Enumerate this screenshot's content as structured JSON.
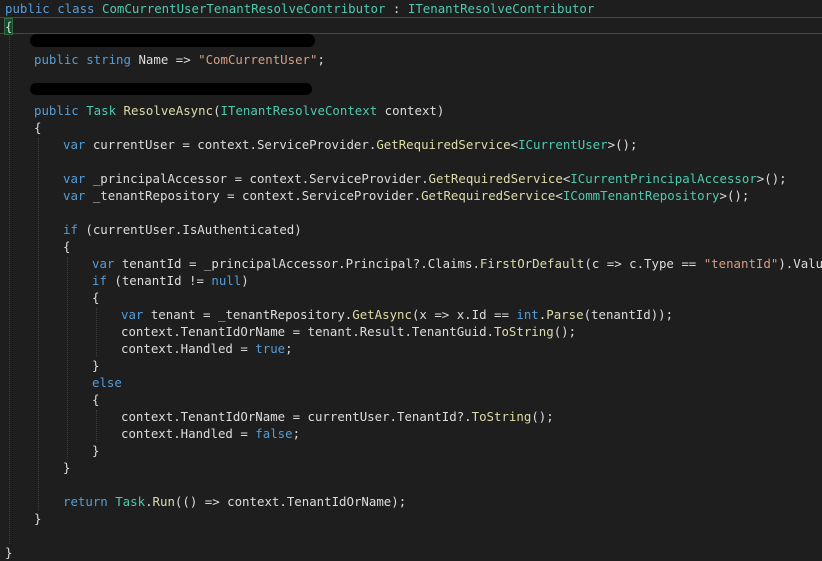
{
  "editor": {
    "lines": [
      {
        "indent": 0,
        "tokens": [
          [
            "keyword",
            "public "
          ],
          [
            "keyword",
            "class "
          ],
          [
            "type",
            "ComCurrentUserTenantResolveContributor"
          ],
          [
            "plain",
            " : "
          ],
          [
            "type",
            "ITenantResolveContributor"
          ]
        ]
      },
      {
        "indent": 0,
        "current": true,
        "tokens": [
          [
            "brace-matched",
            "{"
          ]
        ]
      },
      {
        "indent": 0,
        "tokens": []
      },
      {
        "indent": 1,
        "tokens": [
          [
            "keyword",
            "public "
          ],
          [
            "keyword",
            "string "
          ],
          [
            "plain",
            "Name => "
          ],
          [
            "string",
            "\"ComCurrentUser\""
          ],
          [
            "plain",
            ";"
          ]
        ]
      },
      {
        "indent": 0,
        "tokens": []
      },
      {
        "indent": 0,
        "tokens": []
      },
      {
        "indent": 1,
        "tokens": [
          [
            "keyword",
            "public "
          ],
          [
            "type",
            "Task "
          ],
          [
            "method",
            "ResolveAsync"
          ],
          [
            "plain",
            "("
          ],
          [
            "type",
            "ITenantResolveContext"
          ],
          [
            "plain",
            " context)"
          ]
        ]
      },
      {
        "indent": 1,
        "tokens": [
          [
            "plain",
            "{"
          ]
        ]
      },
      {
        "indent": 2,
        "tokens": [
          [
            "keyword",
            "var "
          ],
          [
            "plain",
            "currentUser = context.ServiceProvider."
          ],
          [
            "method",
            "GetRequiredService"
          ],
          [
            "plain",
            "<"
          ],
          [
            "type",
            "ICurrentUser"
          ],
          [
            "plain",
            ">();"
          ]
        ]
      },
      {
        "indent": 0,
        "tokens": []
      },
      {
        "indent": 2,
        "tokens": [
          [
            "keyword",
            "var "
          ],
          [
            "plain",
            "_principalAccessor = context.ServiceProvider."
          ],
          [
            "method",
            "GetRequiredService"
          ],
          [
            "plain",
            "<"
          ],
          [
            "type",
            "ICurrentPrincipalAccessor"
          ],
          [
            "plain",
            ">();"
          ]
        ]
      },
      {
        "indent": 2,
        "tokens": [
          [
            "keyword",
            "var "
          ],
          [
            "plain",
            "_tenantRepository = context.ServiceProvider."
          ],
          [
            "method",
            "GetRequiredService"
          ],
          [
            "plain",
            "<"
          ],
          [
            "type",
            "ICommTenantRepository"
          ],
          [
            "plain",
            ">();"
          ]
        ]
      },
      {
        "indent": 0,
        "tokens": []
      },
      {
        "indent": 2,
        "tokens": [
          [
            "keyword",
            "if "
          ],
          [
            "plain",
            "(currentUser.IsAuthenticated)"
          ]
        ]
      },
      {
        "indent": 2,
        "tokens": [
          [
            "plain",
            "{"
          ]
        ]
      },
      {
        "indent": 3,
        "tokens": [
          [
            "keyword",
            "var "
          ],
          [
            "plain",
            "tenantId = _principalAccessor.Principal?.Claims."
          ],
          [
            "method",
            "FirstOrDefault"
          ],
          [
            "plain",
            "(c => c.Type == "
          ],
          [
            "string",
            "\"tenantId\""
          ],
          [
            "plain",
            ").Value;"
          ]
        ]
      },
      {
        "indent": 3,
        "tokens": [
          [
            "keyword",
            "if "
          ],
          [
            "plain",
            "(tenantId != "
          ],
          [
            "keyword",
            "null"
          ],
          [
            "plain",
            ")"
          ]
        ]
      },
      {
        "indent": 3,
        "tokens": [
          [
            "plain",
            "{"
          ]
        ]
      },
      {
        "indent": 4,
        "tokens": [
          [
            "keyword",
            "var "
          ],
          [
            "plain",
            "tenant = _tenantRepository."
          ],
          [
            "method",
            "GetAsync"
          ],
          [
            "plain",
            "(x => x.Id == "
          ],
          [
            "keyword",
            "int"
          ],
          [
            "plain",
            "."
          ],
          [
            "method",
            "Parse"
          ],
          [
            "plain",
            "(tenantId));"
          ]
        ]
      },
      {
        "indent": 4,
        "tokens": [
          [
            "plain",
            "context.TenantIdOrName = tenant.Result.TenantGuid."
          ],
          [
            "method",
            "ToString"
          ],
          [
            "plain",
            "();"
          ]
        ]
      },
      {
        "indent": 4,
        "tokens": [
          [
            "plain",
            "context.Handled = "
          ],
          [
            "keyword",
            "true"
          ],
          [
            "plain",
            ";"
          ]
        ]
      },
      {
        "indent": 3,
        "tokens": [
          [
            "plain",
            "}"
          ]
        ]
      },
      {
        "indent": 3,
        "tokens": [
          [
            "keyword",
            "else"
          ]
        ]
      },
      {
        "indent": 3,
        "tokens": [
          [
            "plain",
            "{"
          ]
        ]
      },
      {
        "indent": 4,
        "tokens": [
          [
            "plain",
            "context.TenantIdOrName = currentUser.TenantId?."
          ],
          [
            "method",
            "ToString"
          ],
          [
            "plain",
            "();"
          ]
        ]
      },
      {
        "indent": 4,
        "tokens": [
          [
            "plain",
            "context.Handled = "
          ],
          [
            "keyword",
            "false"
          ],
          [
            "plain",
            ";"
          ]
        ]
      },
      {
        "indent": 3,
        "tokens": [
          [
            "plain",
            "}"
          ]
        ]
      },
      {
        "indent": 2,
        "tokens": [
          [
            "plain",
            "}"
          ]
        ]
      },
      {
        "indent": 0,
        "tokens": []
      },
      {
        "indent": 2,
        "tokens": [
          [
            "keyword",
            "return "
          ],
          [
            "type",
            "Task"
          ],
          [
            "plain",
            "."
          ],
          [
            "method",
            "Run"
          ],
          [
            "plain",
            "(() => context.TenantIdOrName);"
          ]
        ]
      },
      {
        "indent": 1,
        "tokens": [
          [
            "plain",
            "}"
          ]
        ]
      },
      {
        "indent": 0,
        "tokens": []
      },
      {
        "indent": 0,
        "tokens": [
          [
            "plain",
            "}"
          ]
        ]
      }
    ]
  },
  "colors": {
    "background": "#1e1e1e",
    "keyword": "#569cd6",
    "type": "#4ec9b0",
    "method": "#dcdcaa",
    "string": "#d69d85",
    "plain": "#dcdcdc"
  }
}
